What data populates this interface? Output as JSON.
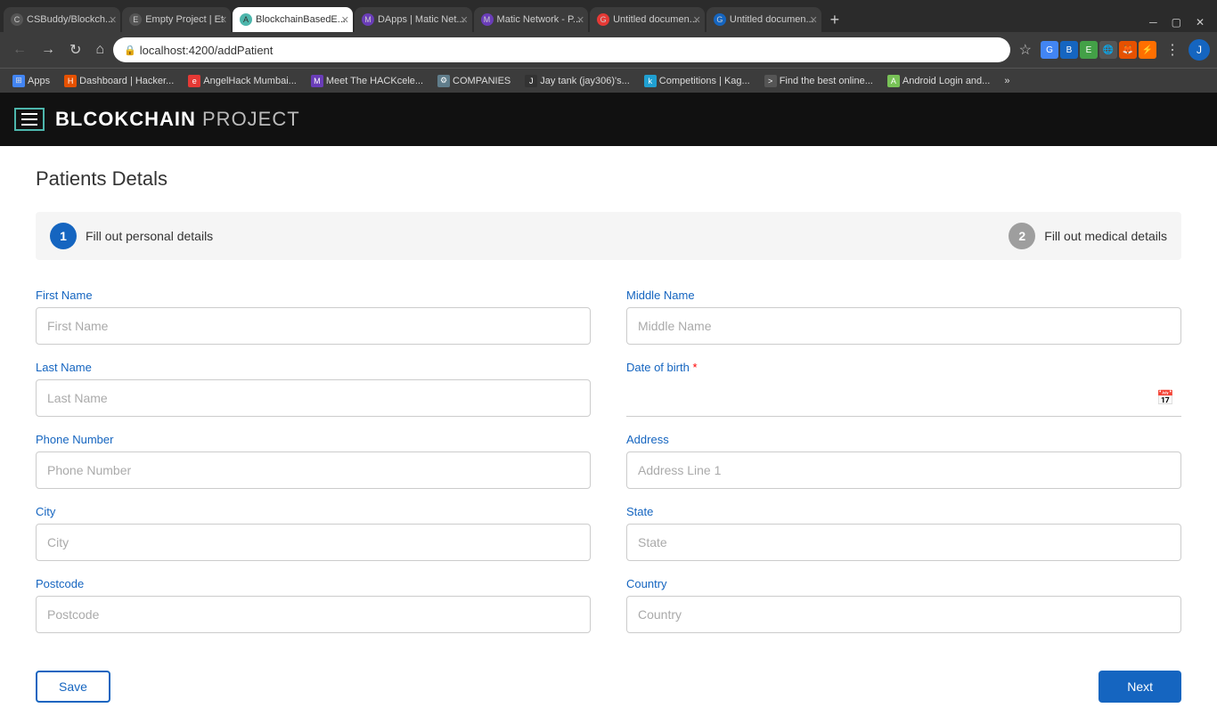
{
  "browser": {
    "tabs": [
      {
        "id": "tab1",
        "label": "CSBuddy/Blockch...",
        "favicon_color": "#555",
        "favicon_text": "C",
        "active": false
      },
      {
        "id": "tab2",
        "label": "Empty Project | Et",
        "favicon_color": "#555",
        "favicon_text": "E",
        "active": false
      },
      {
        "id": "tab3",
        "label": "BlockchainBasedE...",
        "favicon_color": "#4db6ac",
        "favicon_text": "A",
        "active": true
      },
      {
        "id": "tab4",
        "label": "DApps | Matic Net...",
        "favicon_color": "#6a3db8",
        "favicon_text": "M",
        "active": false
      },
      {
        "id": "tab5",
        "label": "Matic Network - P...",
        "favicon_color": "#6a3db8",
        "favicon_text": "M",
        "active": false
      },
      {
        "id": "tab6",
        "label": "Untitled documen...",
        "favicon_color": "#e53935",
        "favicon_text": "G",
        "active": false
      },
      {
        "id": "tab7",
        "label": "Untitled documen...",
        "favicon_color": "#1565c0",
        "favicon_text": "G",
        "active": false
      }
    ],
    "address": "localhost:4200/addPatient",
    "new_tab_label": "+"
  },
  "bookmarks": [
    {
      "id": "bm1",
      "label": "Apps",
      "icon_color": "#4285f4",
      "icon_text": "⊞"
    },
    {
      "id": "bm2",
      "label": "Dashboard | Hacker...",
      "icon_color": "#e65100",
      "icon_text": "H"
    },
    {
      "id": "bm3",
      "label": "AngelHack Mumbai...",
      "icon_color": "#e53935",
      "icon_text": "e"
    },
    {
      "id": "bm4",
      "label": "Meet The HACKcele...",
      "icon_color": "#6a3db8",
      "icon_text": "M"
    },
    {
      "id": "bm5",
      "label": "COMPANIES",
      "icon_color": "#607d8b",
      "icon_text": "⚙"
    },
    {
      "id": "bm6",
      "label": "Jay tank (jay306)'s...",
      "icon_color": "#333",
      "icon_text": "J"
    },
    {
      "id": "bm7",
      "label": "Competitions | Kag...",
      "icon_color": "#20a0d2",
      "icon_text": "k"
    },
    {
      "id": "bm8",
      "label": "Find the best online...",
      "icon_color": "#555",
      "icon_text": ">"
    },
    {
      "id": "bm9",
      "label": "Android Login and...",
      "icon_color": "#78c257",
      "icon_text": "A"
    }
  ],
  "header": {
    "title": "BLCOKCHAIN",
    "subtitle": " PROJECT",
    "menu_icon": "☰"
  },
  "page": {
    "title": "Patients Detals"
  },
  "steps": [
    {
      "id": "step1",
      "number": "1",
      "label": "Fill out personal details",
      "active": true
    },
    {
      "id": "step2",
      "number": "2",
      "label": "Fill out medical details",
      "active": false
    }
  ],
  "form": {
    "left": {
      "first_name": {
        "label": "First Name",
        "placeholder": "First Name"
      },
      "last_name": {
        "label": "Last Name",
        "placeholder": "Last Name"
      },
      "phone_number": {
        "label": "Phone Number",
        "placeholder": "Phone Number"
      },
      "city": {
        "label": "City",
        "placeholder": "City"
      },
      "postcode": {
        "label": "Postcode",
        "placeholder": "Postcode"
      }
    },
    "right": {
      "middle_name": {
        "label": "Middle Name",
        "placeholder": "Middle Name"
      },
      "date_of_birth": {
        "label": "Date of birth",
        "placeholder": ""
      },
      "address": {
        "label": "Address",
        "placeholder": "Address Line 1"
      },
      "state": {
        "label": "State",
        "placeholder": "State"
      },
      "country": {
        "label": "Country",
        "placeholder": "Country"
      }
    }
  },
  "buttons": {
    "save": "Save",
    "next": "Next"
  }
}
